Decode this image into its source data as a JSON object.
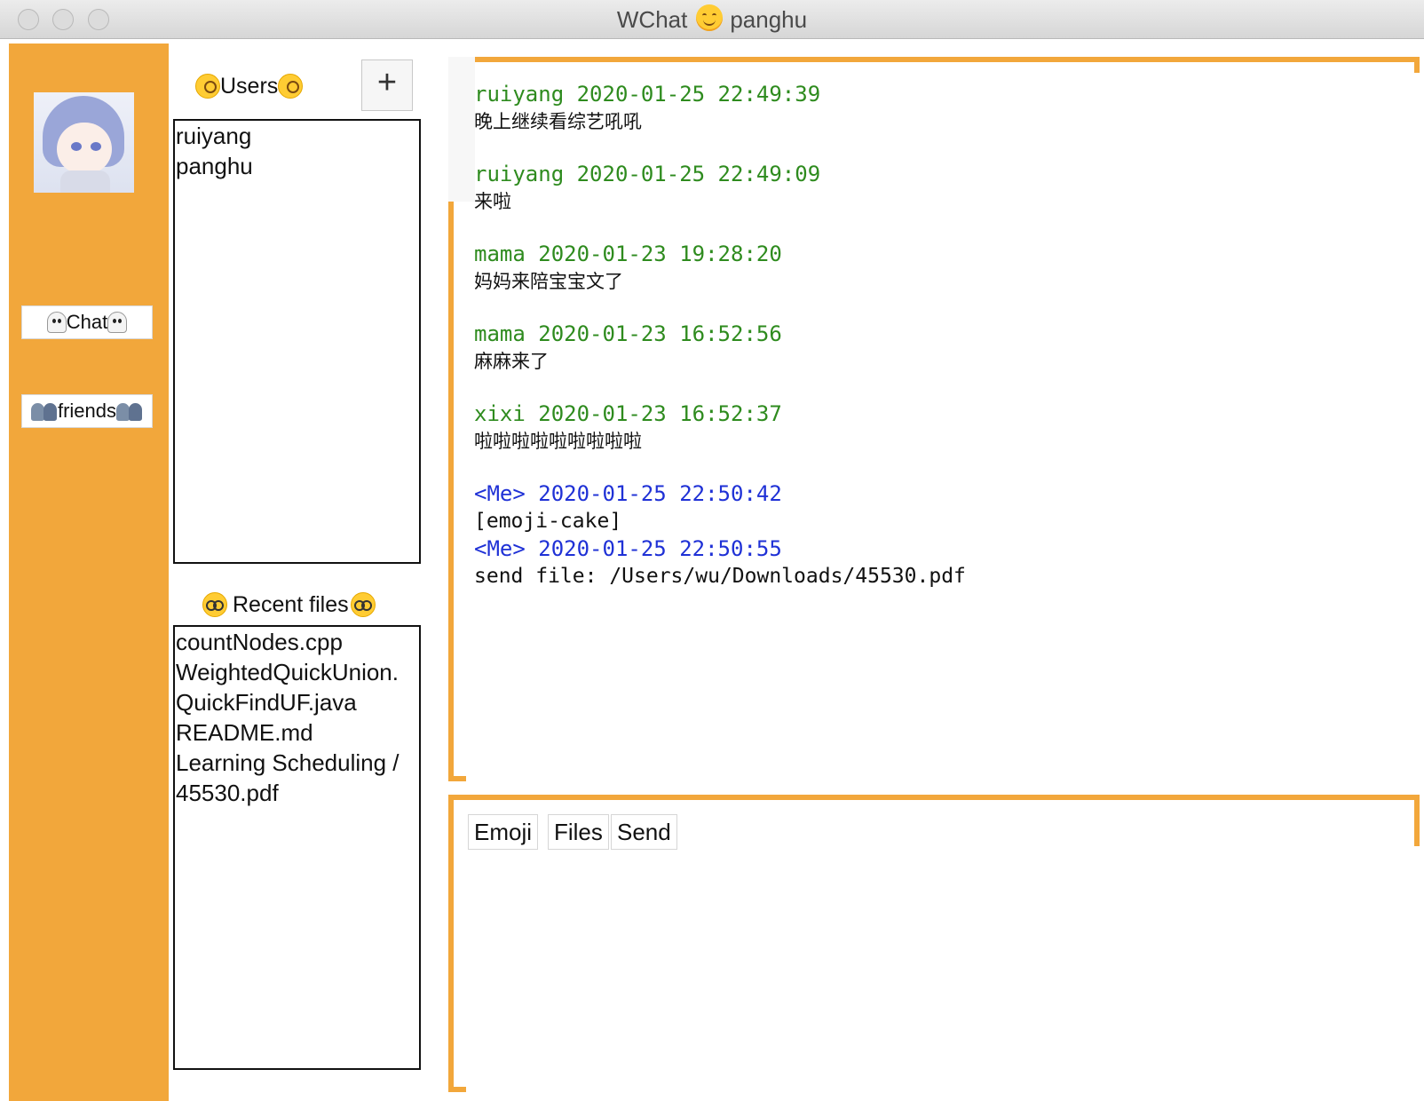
{
  "window": {
    "title_app": "WChat",
    "title_user": "panghu",
    "title_icon": "smiling-face-icon"
  },
  "sidebar": {
    "background": "#f2a73b",
    "avatar_icon": "anime-girl-avatar",
    "nav": [
      {
        "label": "Chat",
        "icon": "ghost-icon"
      },
      {
        "label": "friends",
        "icon": "people-icon"
      }
    ]
  },
  "users": {
    "header": "Users",
    "header_icon": "monocle-face-icon",
    "add_label": "+",
    "items": [
      "ruiyang",
      "panghu"
    ]
  },
  "recent_files": {
    "header": "Recent files",
    "header_icon": "nerd-face-icon",
    "items": [
      "countNodes.cpp",
      "WeightedQuickUnion.",
      "QuickFindUF.java",
      "README.md",
      "Learning Scheduling /",
      "45530.pdf"
    ]
  },
  "messages": [
    {
      "sender": "ruiyang",
      "time": "2020-01-25 22:49:39",
      "text": "晚上继续看综艺吼吼",
      "me": false
    },
    {
      "sender": "ruiyang",
      "time": "2020-01-25 22:49:09",
      "text": "来啦",
      "me": false
    },
    {
      "sender": "mama",
      "time": "2020-01-23 19:28:20",
      "text": "妈妈来陪宝宝文了",
      "me": false
    },
    {
      "sender": "mama",
      "time": "2020-01-23 16:52:56",
      "text": "麻麻来了",
      "me": false
    },
    {
      "sender": "xixi",
      "time": "2020-01-23 16:52:37",
      "text": "啦啦啦啦啦啦啦啦啦",
      "me": false
    },
    {
      "sender": "<Me>",
      "time": "2020-01-25 22:50:42",
      "text": "[emoji-cake]",
      "me": true
    },
    {
      "sender": "<Me>",
      "time": "2020-01-25 22:50:55",
      "text": "send file: /Users/wu/Downloads/45530.pdf",
      "me": true
    }
  ],
  "composer": {
    "emoji_label": "Emoji",
    "files_label": "Files",
    "send_label": "Send",
    "input_value": ""
  },
  "colors": {
    "accent": "#f2a73b",
    "sender_other": "#2e8b1e",
    "sender_me": "#1f31d6"
  }
}
